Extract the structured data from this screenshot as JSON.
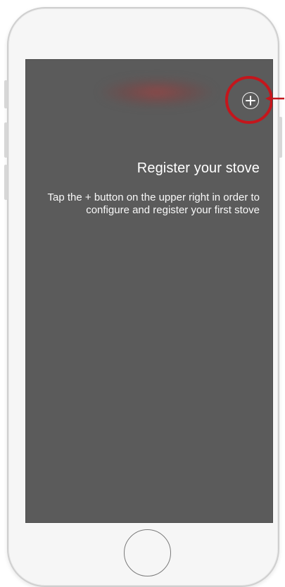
{
  "screen": {
    "title": "Register your stove",
    "description": "Tap the + button on the upper right in order to configure and register your first stove"
  },
  "icons": {
    "plus": "plus-circle-icon",
    "callout_arrow": "arrow-left-icon"
  },
  "colors": {
    "screen_background": "#5b5b5b",
    "text": "#ffffff",
    "callout": "#c4161c",
    "phone_body": "#f6f6f6"
  }
}
